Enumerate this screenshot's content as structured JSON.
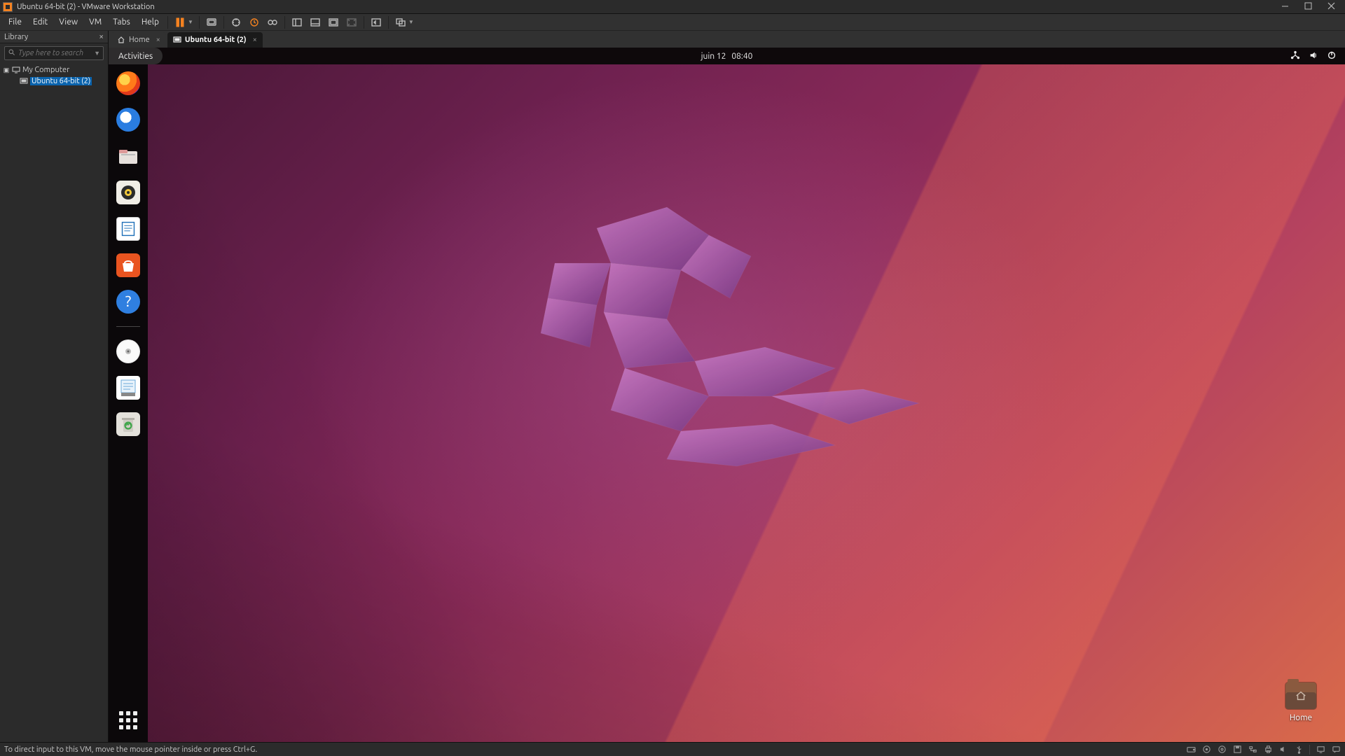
{
  "window": {
    "title": "Ubuntu 64-bit (2) - VMware Workstation"
  },
  "menubar": {
    "items": [
      "File",
      "Edit",
      "View",
      "VM",
      "Tabs",
      "Help"
    ]
  },
  "library": {
    "title": "Library",
    "search_placeholder": "Type here to search",
    "root_label": "My Computer",
    "selected_vm": "Ubuntu 64-bit (2)"
  },
  "tabs": {
    "home_label": "Home",
    "vm_label": "Ubuntu 64-bit (2)"
  },
  "gnome": {
    "activities": "Activities",
    "date": "juin 12",
    "time": "08:40"
  },
  "desktop": {
    "home_label": "Home"
  },
  "statusbar": {
    "hint": "To direct input to this VM, move the mouse pointer inside or press Ctrl+G."
  }
}
